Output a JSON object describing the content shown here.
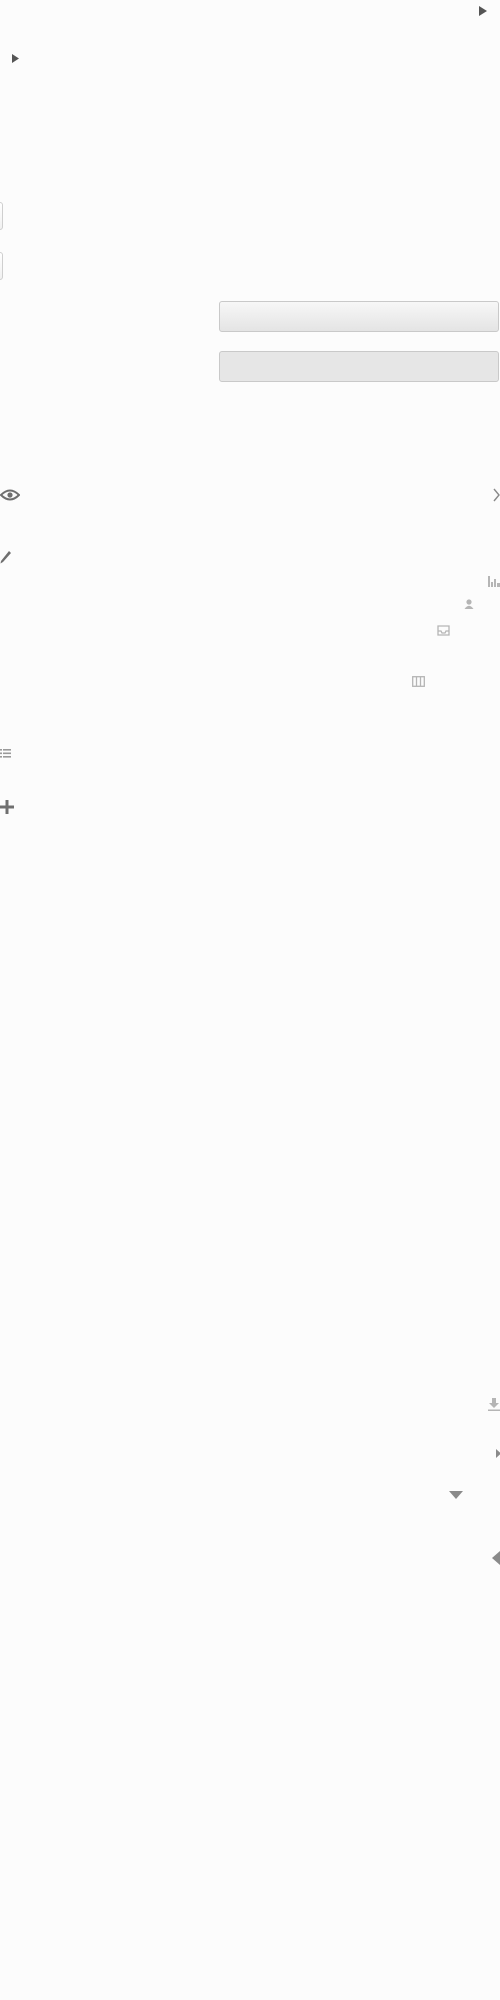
{
  "header": {
    "collapse_arrow_icon": "triangle-right-icon"
  },
  "tree": {
    "expand_arrow_icon": "triangle-right-icon"
  },
  "controls": {
    "stub_1": "",
    "stub_2": ""
  },
  "bars": {
    "bar_1": "",
    "bar_2": ""
  },
  "icons": [
    "eye-icon",
    "chevron-right-icon",
    "pencil-icon",
    "bar-chart-icon",
    "user-icon",
    "inbox-icon",
    "columns-icon",
    "list-icon",
    "move-icon",
    "download-icon",
    "small-triangle-right-icon",
    "triangle-down-icon",
    "triangle-left-icon"
  ],
  "colors": {
    "background": "#fcfcfc",
    "icon": "#7a7a7a",
    "icon_light": "#b5b5b5",
    "border": "#c9c9c9"
  }
}
